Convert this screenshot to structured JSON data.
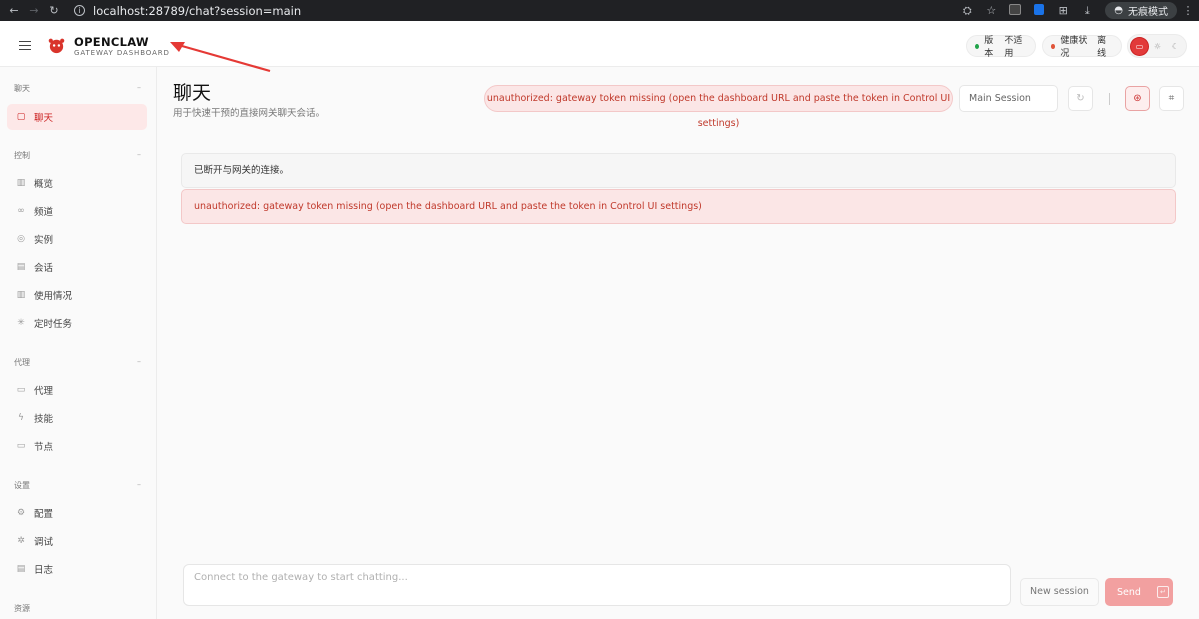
{
  "browser": {
    "url": "localhost:28789/chat?session=main",
    "incognito_label": "无痕模式"
  },
  "header": {
    "brand_title": "OPENCLAW",
    "brand_subtitle": "GATEWAY DASHBOARD",
    "version_label": "版本",
    "version_value": "不适用",
    "health_label": "健康状况",
    "health_value": "离线",
    "colors": {
      "version_dot": "#22a44a",
      "health_dot": "#e0553a",
      "accent": "#e23a3a"
    }
  },
  "sidebar": {
    "sections": [
      {
        "title": "聊天",
        "items": [
          {
            "label": "聊天",
            "icon": "chat-bubble-icon",
            "active": true
          }
        ]
      },
      {
        "title": "控制",
        "items": [
          {
            "label": "概览",
            "icon": "bar-chart-icon"
          },
          {
            "label": "频道",
            "icon": "link-icon"
          },
          {
            "label": "实例",
            "icon": "radio-signal-icon"
          },
          {
            "label": "会话",
            "icon": "document-icon"
          },
          {
            "label": "使用情况",
            "icon": "bar-chart-icon"
          },
          {
            "label": "定时任务",
            "icon": "loader-icon"
          }
        ]
      },
      {
        "title": "代理",
        "items": [
          {
            "label": "代理",
            "icon": "folder-icon"
          },
          {
            "label": "技能",
            "icon": "lightning-icon"
          },
          {
            "label": "节点",
            "icon": "monitor-icon"
          }
        ]
      },
      {
        "title": "设置",
        "items": [
          {
            "label": "配置",
            "icon": "gear-icon"
          },
          {
            "label": "调试",
            "icon": "bug-icon"
          },
          {
            "label": "日志",
            "icon": "scroll-icon"
          }
        ]
      },
      {
        "title": "资源",
        "items": []
      }
    ]
  },
  "main": {
    "title": "聊天",
    "subtitle": "用于快速干预的直接网关聊天会话。",
    "error_banner": "unauthorized: gateway token missing (open the dashboard URL and paste the token in Control UI settings)",
    "session_value": "Main Session",
    "messages": {
      "disconnected": "已断开与网关的连接。",
      "error": "unauthorized: gateway token missing (open the dashboard URL and paste the token in Control UI settings)"
    },
    "composer": {
      "placeholder": "Connect to the gateway to start chatting...",
      "new_session_label": "New session",
      "send_label": "Send"
    }
  }
}
